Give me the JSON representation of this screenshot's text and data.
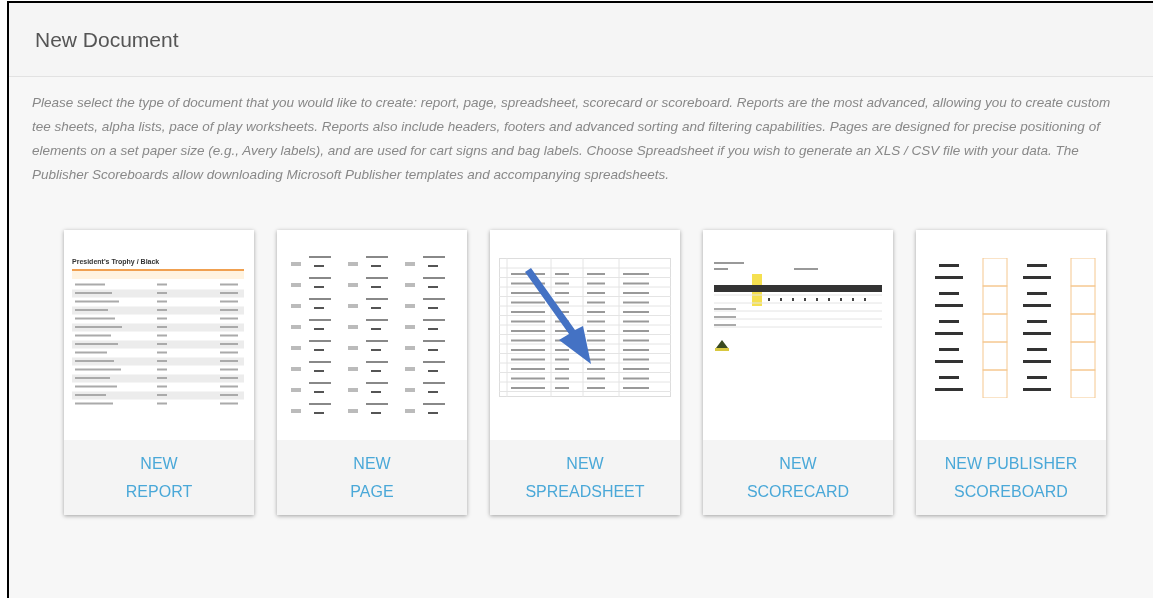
{
  "header": {
    "title": "New Document"
  },
  "description": "Please select the type of document that you would like to create: report, page, spreadsheet, scorecard or scoreboard. Reports are the most advanced, allowing you to create custom tee sheets, alpha lists, pace of play worksheets. Reports also include headers, footers and advanced sorting and filtering capabilities. Pages are designed for precise positioning of elements on a set paper size (e.g., Avery labels), and are used for cart signs and bag labels. Choose Spreadsheet if you wish to generate an XLS / CSV file with your data. The Publisher Scoreboards allow downloading Microsoft Publisher templates and accompanying spreadsheets.",
  "cards": [
    {
      "kind": "report",
      "preview_title": "President's Trophy / Black",
      "label_lines": [
        "NEW",
        "REPORT"
      ]
    },
    {
      "kind": "page",
      "label_lines": [
        "NEW",
        "PAGE"
      ]
    },
    {
      "kind": "spreadsheet",
      "label_lines": [
        "NEW",
        "SPREADSHEET"
      ]
    },
    {
      "kind": "scorecard",
      "label_lines": [
        "NEW",
        "SCORECARD"
      ]
    },
    {
      "kind": "publisher",
      "label_lines": [
        "NEW PUBLISHER",
        "SCOREBOARD"
      ]
    }
  ]
}
